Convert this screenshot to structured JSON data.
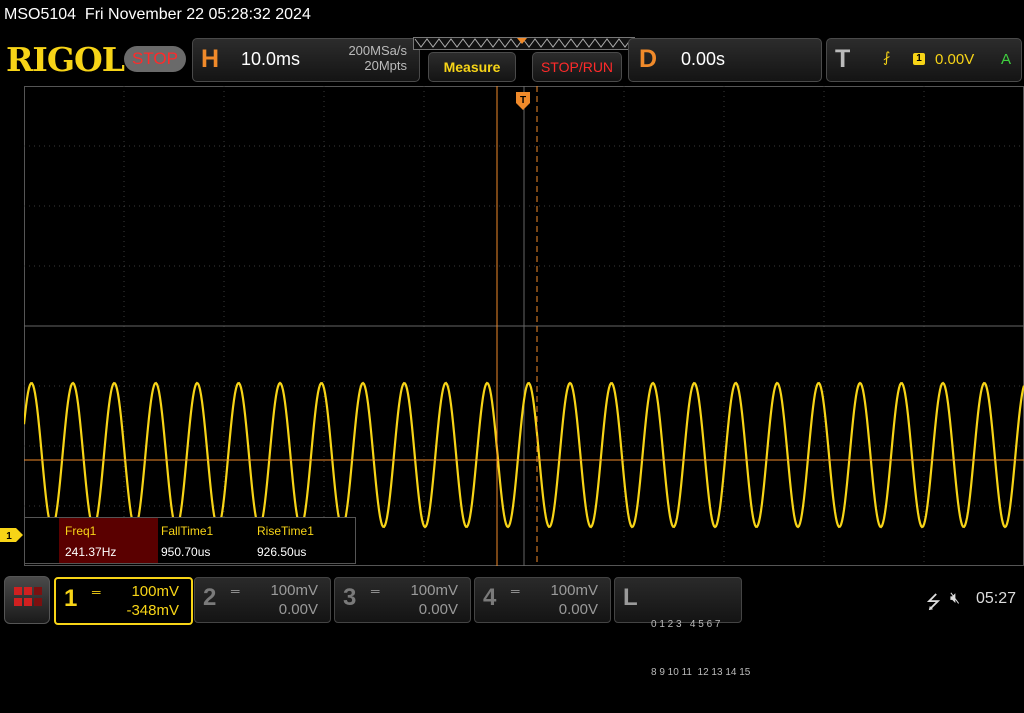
{
  "header": {
    "model_datetime": "MSO5104  Fri November 22 05:28:32 2024"
  },
  "brand": "RIGOL",
  "run_state": "STOP",
  "horizontal": {
    "letter": "H",
    "timebase": "10.0ms",
    "sample_rate": "200MSa/s",
    "memory_depth": "20Mpts"
  },
  "buttons": {
    "measure": "Measure",
    "stop_run": "STOP/RUN"
  },
  "delay": {
    "letter": "D",
    "value": "0.00s"
  },
  "trigger": {
    "letter": "T",
    "source": "1",
    "level": "0.00V",
    "mode": "A"
  },
  "markers": {
    "trigger_marker": "T",
    "ch1_marker": "1"
  },
  "measurements": [
    {
      "name": "Freq1",
      "value": "241.37Hz"
    },
    {
      "name": "FallTime1",
      "value": "950.70us"
    },
    {
      "name": "RiseTime1",
      "value": "926.50us"
    }
  ],
  "channels": [
    {
      "num": "1",
      "scale": "100mV",
      "offset": "-348mV"
    },
    {
      "num": "2",
      "scale": "100mV",
      "offset": "0.00V"
    },
    {
      "num": "3",
      "scale": "100mV",
      "offset": "0.00V"
    },
    {
      "num": "4",
      "scale": "100mV",
      "offset": "0.00V"
    }
  ],
  "logic": {
    "letter": "L",
    "row1": "0 1 2 3   4 5 6 7",
    "row2": "8 9 10 11  12 13 14 15"
  },
  "status": {
    "time": "05:27"
  },
  "colors": {
    "ch1": "#f7d417",
    "accent": "#f08a2a",
    "stop": "#ff2a2a",
    "trigger_mode": "#3fd13f"
  },
  "waveform": {
    "channel": "1",
    "shape": "sine",
    "frequency_hz": 241.37,
    "timebase_per_div_s": 0.01
  }
}
